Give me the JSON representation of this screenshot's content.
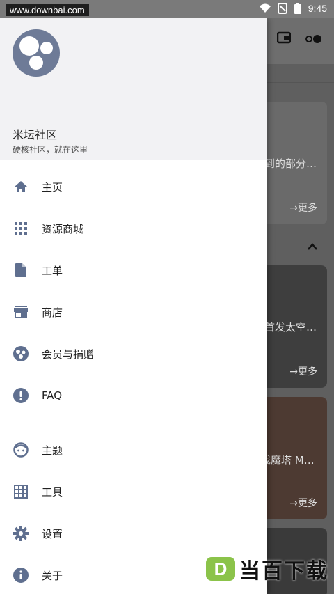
{
  "status_bar": {
    "watermark": "www.downbai.com",
    "time": "9:45"
  },
  "background": {
    "cards": [
      {
        "title": "到的部分…",
        "more": "→更多"
      },
      {
        "title": "首发太空…",
        "more": "→更多"
      },
      {
        "title": "戏魔塔 M…",
        "more": "→更多"
      }
    ]
  },
  "drawer": {
    "app_name": "米坛社区",
    "subtitle": "硬核社区，就在这里",
    "items": [
      {
        "label": "主页",
        "icon": "home-icon"
      },
      {
        "label": "资源商城",
        "icon": "grid-icon"
      },
      {
        "label": "工单",
        "icon": "document-icon"
      },
      {
        "label": "商店",
        "icon": "store-icon"
      },
      {
        "label": "会员与捐赠",
        "icon": "membership-icon"
      },
      {
        "label": "FAQ",
        "icon": "alert-icon"
      },
      {
        "label": "主题",
        "icon": "face-icon"
      },
      {
        "label": "工具",
        "icon": "table-icon"
      },
      {
        "label": "设置",
        "icon": "settings-icon"
      },
      {
        "label": "关于",
        "icon": "info-icon"
      }
    ]
  },
  "logo": {
    "mark": "D",
    "text": "当百下载"
  },
  "colors": {
    "icon": "#5f6f8f",
    "accent_green": "#8bc34a"
  }
}
